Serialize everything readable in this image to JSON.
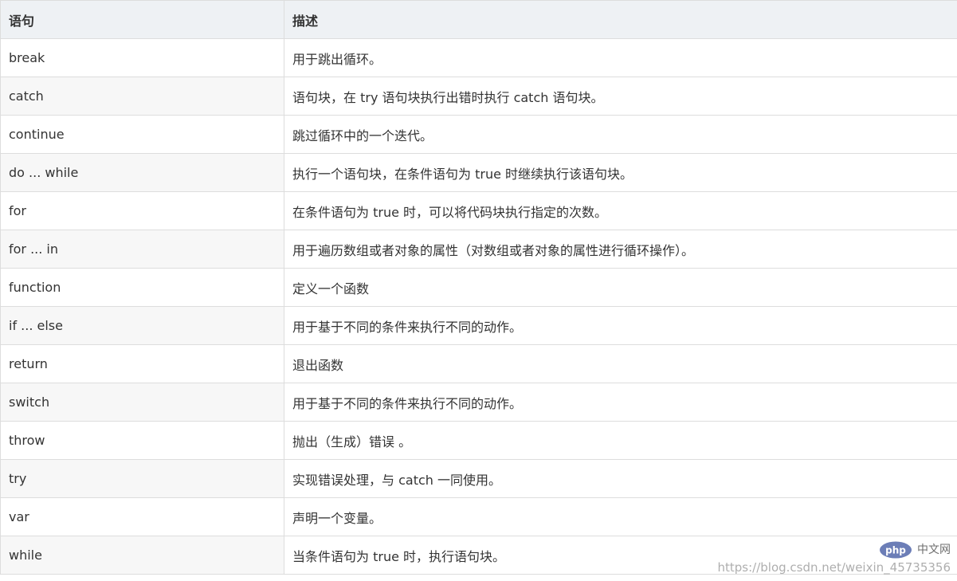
{
  "table": {
    "headers": {
      "statement": "语句",
      "description": "描述"
    },
    "rows": [
      {
        "statement": "break",
        "description": "用于跳出循环。"
      },
      {
        "statement": "catch",
        "description": "语句块，在 try 语句块执行出错时执行 catch 语句块。"
      },
      {
        "statement": "continue",
        "description": "跳过循环中的一个迭代。"
      },
      {
        "statement": "do ... while",
        "description": "执行一个语句块，在条件语句为 true 时继续执行该语句块。"
      },
      {
        "statement": "for",
        "description": "在条件语句为 true 时，可以将代码块执行指定的次数。"
      },
      {
        "statement": "for ... in",
        "description": "用于遍历数组或者对象的属性（对数组或者对象的属性进行循环操作）。"
      },
      {
        "statement": "function",
        "description": "定义一个函数"
      },
      {
        "statement": "if ... else",
        "description": "用于基于不同的条件来执行不同的动作。"
      },
      {
        "statement": "return",
        "description": "退出函数"
      },
      {
        "statement": "switch",
        "description": "用于基于不同的条件来执行不同的动作。"
      },
      {
        "statement": "throw",
        "description": "抛出（生成）错误 。"
      },
      {
        "statement": "try",
        "description": "实现错误处理，与 catch 一同使用。"
      },
      {
        "statement": "var",
        "description": "声明一个变量。"
      },
      {
        "statement": "while",
        "description": "当条件语句为 true 时，执行语句块。"
      }
    ]
  },
  "watermark": {
    "logo_text": "php",
    "site_label": "中文网",
    "url": "https://blog.csdn.net/weixin_45735356"
  },
  "colors": {
    "header_bg": "#eef1f4",
    "border": "#dddddd",
    "text": "#333333",
    "php_logo": "#6c7eb7"
  }
}
